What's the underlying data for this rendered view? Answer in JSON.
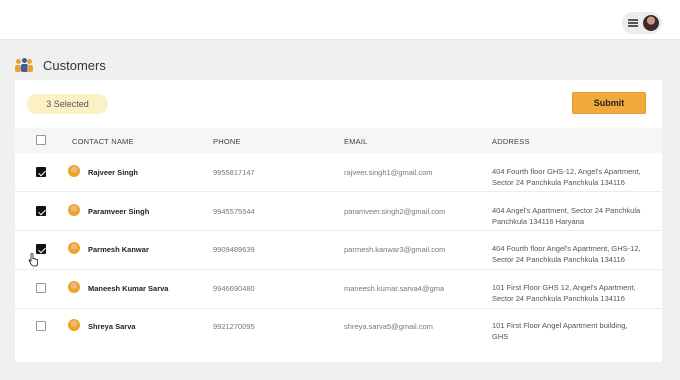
{
  "page": {
    "title": "Customers"
  },
  "selection": {
    "label": "3 Selected"
  },
  "actions": {
    "submit_label": "Submit"
  },
  "table": {
    "headers": {
      "name": "CONTACT NAME",
      "phone": "PHONE",
      "email": "EMAIL",
      "address": "ADDRESS"
    },
    "rows": [
      {
        "checked": true,
        "name": "Rajveer Singh",
        "phone": "9955817147",
        "email": "rajveer.singh1@gmail.com",
        "address": "404 Fourth floor GHS-12, Angel's Apartment, Sector 24 Panchkula Panchkula 134116 Haryana"
      },
      {
        "checked": true,
        "name": "Paramveer Singh",
        "phone": "9945575544",
        "email": "paramveer.singh2@gmail.com",
        "address": "404 Angel's Apartment, Sector 24 Panchkula Panchkula 134116 Haryana"
      },
      {
        "checked": true,
        "name": "Parmesh Kanwar",
        "phone": "9909489639",
        "email": "parmesh.kanwar3@gmail.com",
        "address": "404 Fourth floor Angel's Apartment, GHS-12, Sector 24 Panchkula Panchkula 134116 Haryana"
      },
      {
        "checked": false,
        "name": "Maneesh Kumar Sarva",
        "phone": "9946690480",
        "email": "maneesh.kumar.sarva4@gmail.com",
        "address": "101 First Floor GHS 12, Angel's Apartment, Sector 24 Panchkula Panchkula 134116"
      },
      {
        "checked": false,
        "name": "Shreya Sarva",
        "phone": "9921270095",
        "email": "shreya.sarva5@gmail.com",
        "address": "101 First Floor Angel Apartment building, GHS"
      }
    ]
  },
  "icons": {
    "menu": "hamburger-icon",
    "user": "user-avatar-icon",
    "customers": "people-icon",
    "cursor": "hand-pointer-icon"
  },
  "colors": {
    "accent": "#f2a93b",
    "selected_pill": "#fbf1c4"
  }
}
